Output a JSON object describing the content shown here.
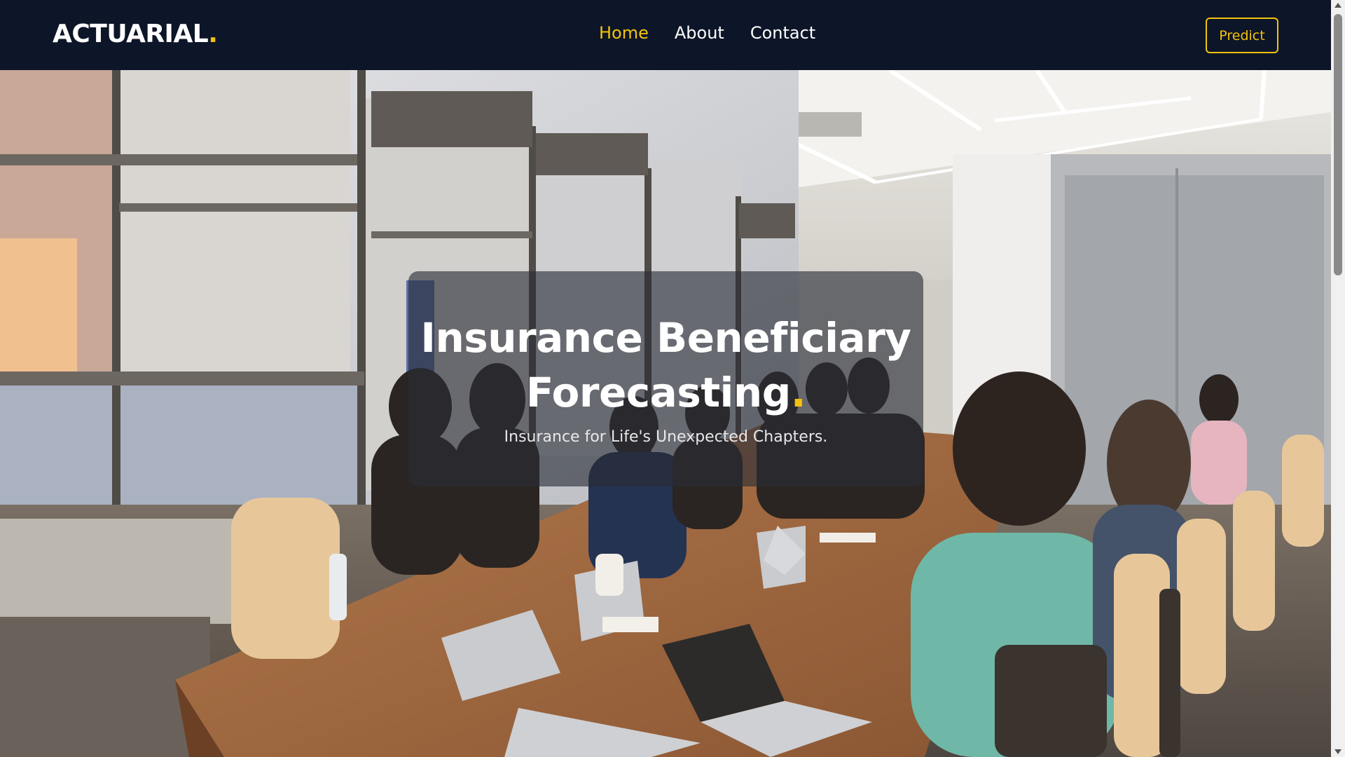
{
  "header": {
    "brand_text": "ACTUARIAL",
    "brand_accent": ".",
    "nav": [
      {
        "label": "Home",
        "active": true
      },
      {
        "label": "About",
        "active": false
      },
      {
        "label": "Contact",
        "active": false
      }
    ],
    "cta_label": "Predict"
  },
  "hero": {
    "title_line1": "Insurance Beneficiary",
    "title_line2": "Forecasting",
    "title_accent": ".",
    "subtitle": "Insurance for Life's Unexpected Chapters.",
    "background_image": "office-meeting-photo"
  },
  "colors": {
    "navbar_bg": "#0d1628",
    "accent": "#f4c20d",
    "text_light": "#ffffff"
  },
  "icons": {
    "scroll_up": "triangle-up",
    "scroll_down": "triangle-down"
  }
}
